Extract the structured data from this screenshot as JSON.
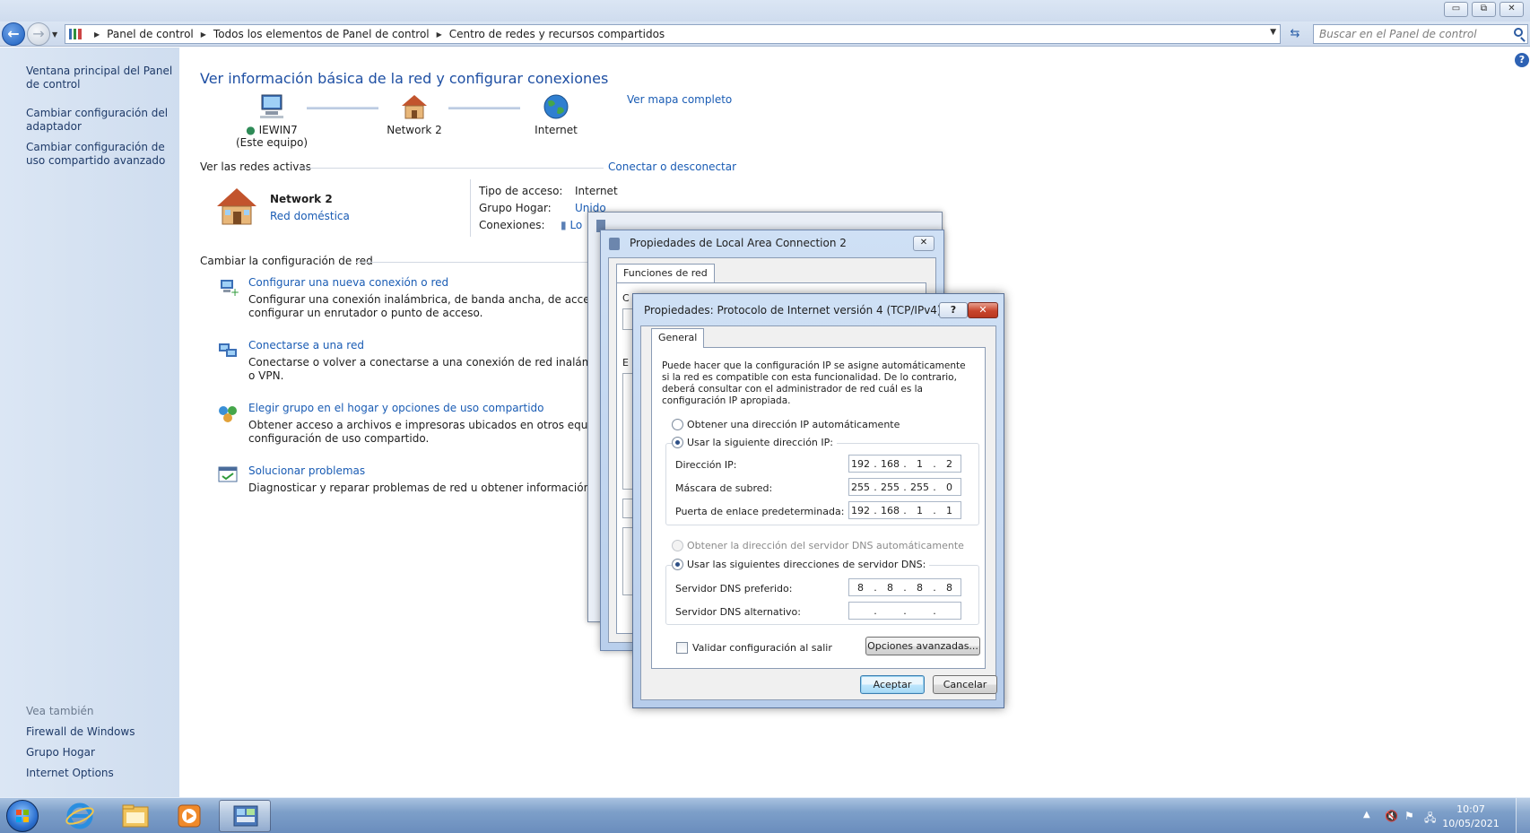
{
  "window": {
    "minimize_glyph": "▭",
    "restore_glyph": "⧉",
    "close_glyph": "✕"
  },
  "navigation": {
    "breadcrumbs": [
      "Panel de control",
      "Todos los elementos de Panel de control",
      "Centro de redes y recursos compartidos"
    ],
    "search_placeholder": "Buscar en el Panel de control"
  },
  "left_pane": {
    "links": [
      "Ventana principal del Panel de control",
      "Cambiar configuración del adaptador",
      "Cambiar configuración de uso compartido avanzado"
    ],
    "see_also_heading": "Vea también",
    "see_also": [
      "Firewall de Windows",
      "Grupo Hogar",
      "Internet Options"
    ]
  },
  "main": {
    "title": "Ver información básica de la red y configurar conexiones",
    "network_map": {
      "computer_name": "IEWIN7",
      "computer_sub": "(Este equipo)",
      "network_name": "Network  2",
      "internet": "Internet",
      "full_map_link": "Ver mapa completo"
    },
    "active_networks": {
      "heading": "Ver las redes activas",
      "connect_link": "Conectar o desconectar",
      "network_name": "Network  2",
      "network_type": "Red doméstica",
      "access_type_label": "Tipo de acceso:",
      "access_type_value": "Internet",
      "homegroup_label": "Grupo Hogar:",
      "homegroup_value": "Unido",
      "connections_label": "Conexiones:",
      "connections_value": "Lo"
    },
    "change_settings": {
      "heading": "Cambiar la configuración de red",
      "tasks": [
        {
          "title": "Configurar una nueva conexión o red",
          "desc": "Configurar una conexión inalámbrica, de banda ancha, de acceso telefó\nconfigurar un enrutador o punto de acceso."
        },
        {
          "title": "Conectarse a una red",
          "desc": "Conectarse o volver a conectarse a una conexión de red inalámbrica, cab\no VPN."
        },
        {
          "title": "Elegir grupo en el hogar y opciones de uso compartido",
          "desc": "Obtener acceso a archivos e impresoras ubicados en otros equipos de la\nconfiguración de uso compartido."
        },
        {
          "title": "Solucionar problemas",
          "desc": "Diagnosticar y reparar problemas de red u obtener información de soluc"
        }
      ]
    }
  },
  "props_dialog": {
    "title": "Propiedades de Local Area Connection 2",
    "tab": "Funciones de red",
    "fragment_1": "C",
    "fragment_2": "E"
  },
  "ipv4_dialog": {
    "title": "Propiedades: Protocolo de Internet versión 4 (TCP/IPv4)",
    "help_glyph": "?",
    "close_glyph": "✕",
    "tab": "General",
    "intro": "Puede hacer que la configuración IP se asigne automáticamente si la red es compatible con esta funcionalidad. De lo contrario, deberá consultar con el administrador de red cuál es la configuración IP apropiada.",
    "radio_ip_auto": "Obtener una dirección IP automáticamente",
    "radio_ip_manual": "Usar la siguiente dirección IP:",
    "ip_address_label": "Dirección IP:",
    "ip_address": [
      "192",
      "168",
      "1",
      "2"
    ],
    "subnet_label": "Máscara de subred:",
    "subnet": [
      "255",
      "255",
      "255",
      "0"
    ],
    "gateway_label": "Puerta de enlace predeterminada:",
    "gateway": [
      "192",
      "168",
      "1",
      "1"
    ],
    "radio_dns_auto": "Obtener la dirección del servidor DNS automáticamente",
    "radio_dns_manual": "Usar las siguientes direcciones de servidor DNS:",
    "dns_preferred_label": "Servidor DNS preferido:",
    "dns_preferred": [
      "8",
      "8",
      "8",
      "8"
    ],
    "dns_alternate_label": "Servidor DNS alternativo:",
    "dns_alternate": [
      "",
      "",
      "",
      ""
    ],
    "validate_label": "Validar configuración al salir",
    "advanced_button": "Opciones avanzadas...",
    "ok_button": "Aceptar",
    "cancel_button": "Cancelar"
  },
  "taskbar": {
    "clock_time": "10:07",
    "clock_date": "10/05/2021"
  },
  "colors": {
    "link": "#1a5cb4",
    "title": "#1e4fa3",
    "left_pane": "#d6e2f2",
    "taskbar": "#7d9fc9"
  }
}
